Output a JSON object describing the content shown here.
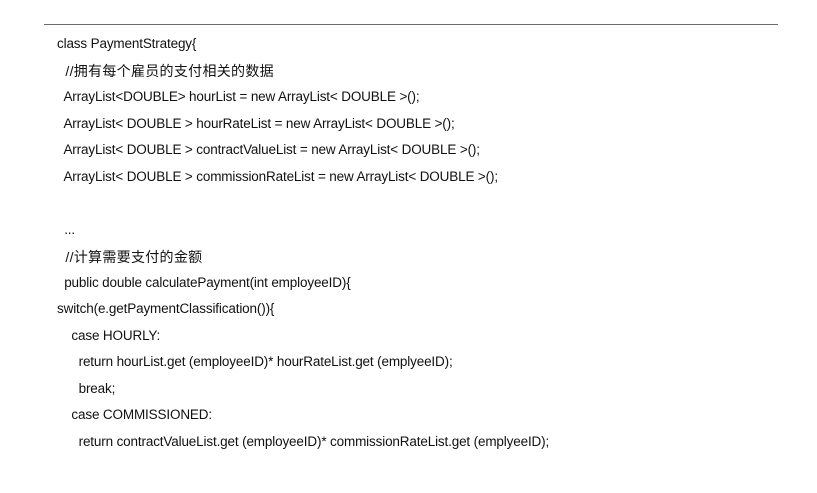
{
  "code_lines": [
    "class PaymentStrategy{",
    "  //拥有每个雇员的支付相关的数据",
    "  ArrayList<DOUBLE> hourList = new ArrayList< DOUBLE >();",
    "  ArrayList< DOUBLE > hourRateList = new ArrayList< DOUBLE >();",
    "  ArrayList< DOUBLE > contractValueList = new ArrayList< DOUBLE >();",
    "  ArrayList< DOUBLE > commissionRateList = new ArrayList< DOUBLE >();",
    "",
    "  ...",
    "  //计算需要支付的金额",
    "  public double calculatePayment(int employeeID){",
    "switch(e.getPaymentClassification()){",
    "    case HOURLY:",
    "      return hourList.get (employeeID)* hourRateList.get (emplyeeID);",
    "      break;",
    "    case COMMISSIONED:",
    "      return contractValueList.get (employeeID)* commissionRateList.get (emplyeeID);"
  ]
}
